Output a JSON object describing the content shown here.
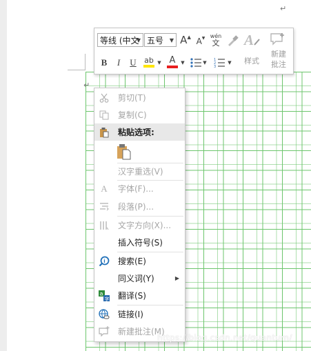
{
  "document": {
    "paragraph_mark": "↵"
  },
  "mini_toolbar": {
    "font_name": "等线 (中文",
    "font_size": "五号",
    "grow_font_label": "A",
    "shrink_font_label": "A",
    "phonetic_top": "wén",
    "phonetic_bottom": "文",
    "bold": "B",
    "italic": "I",
    "highlight_label": "ab",
    "font_color_label": "A",
    "styles_label": "样式",
    "new_comment_label_1": "新建",
    "new_comment_label_2": "批注",
    "colors": {
      "highlight": "#ffe600",
      "font_color": "#e81e1e"
    }
  },
  "context_menu": {
    "items": [
      {
        "label": "剪切(T)",
        "icon": "scissors-icon",
        "enabled": false
      },
      {
        "label": "复制(C)",
        "icon": "copy-icon",
        "enabled": false
      },
      {
        "label": "粘贴选项:",
        "icon": "paste-icon",
        "enabled": true,
        "bold": true
      },
      {
        "label": "汉字重选(V)",
        "icon": "",
        "enabled": false
      },
      {
        "label": "字体(F)...",
        "icon": "font-icon",
        "enabled": false
      },
      {
        "label": "段落(P)...",
        "icon": "paragraph-icon",
        "enabled": false
      },
      {
        "label": "文字方向(X)...",
        "icon": "text-direction-icon",
        "enabled": false
      },
      {
        "label": "插入符号(S)",
        "icon": "",
        "enabled": true
      },
      {
        "label": "搜索(E)",
        "icon": "search-icon",
        "enabled": true
      },
      {
        "label": "同义词(Y)",
        "icon": "",
        "enabled": true,
        "submenu": true
      },
      {
        "label": "翻译(S)",
        "icon": "translate-icon",
        "enabled": true
      },
      {
        "label": "链接(I)",
        "icon": "link-icon",
        "enabled": true
      },
      {
        "label": "新建批注(M)",
        "icon": "new-comment-icon",
        "enabled": false
      }
    ]
  },
  "watermark": "https://blog.csdn.net/quantum/"
}
